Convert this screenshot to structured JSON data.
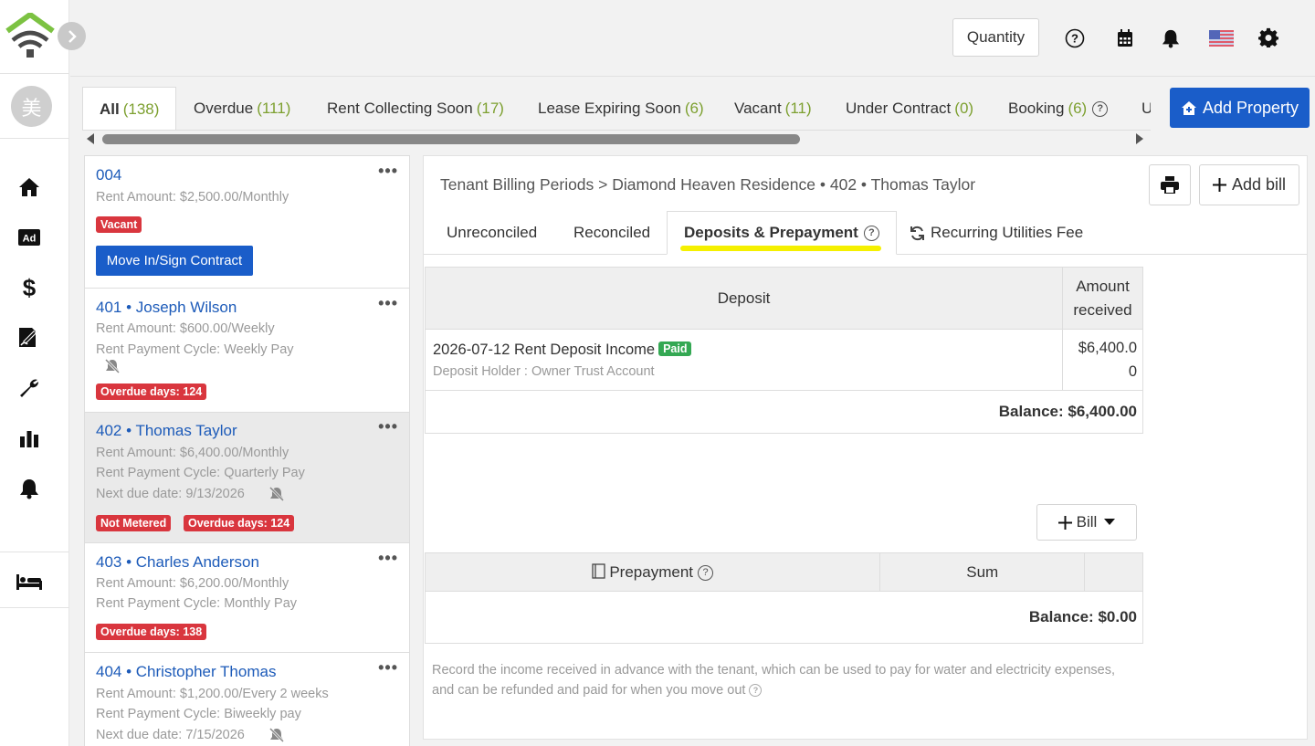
{
  "sidebar": {
    "avatar_char": "美",
    "nav_icons": [
      "home-icon",
      "ad-icon",
      "dollar-icon",
      "contract-icon",
      "wrench-icon",
      "chart-icon",
      "bell-icon",
      "bed-icon"
    ]
  },
  "topbar": {
    "quantity_label": "Quantity",
    "icons": [
      "help-icon",
      "calendar-icon",
      "notification-icon",
      "us-flag-icon",
      "settings-icon"
    ]
  },
  "property_tabs": [
    {
      "label": "All",
      "count": "(138)"
    },
    {
      "label": "Overdue",
      "count": "(111)"
    },
    {
      "label": "Rent Collecting Soon",
      "count": "(17)"
    },
    {
      "label": "Lease Expiring Soon",
      "count": "(6)"
    },
    {
      "label": "Vacant",
      "count": "(11)"
    },
    {
      "label": "Under Contract",
      "count": "(0)"
    },
    {
      "label": "Booking",
      "count": "(6)"
    },
    {
      "label": "U",
      "count": ""
    }
  ],
  "add_property_label": "Add Property",
  "properties": [
    {
      "title": "004",
      "lines": [
        "Rent Amount: $2,500.00/Monthly"
      ],
      "badges": [
        "Vacant"
      ],
      "action": "Move In/Sign Contract"
    },
    {
      "title": "401 • Joseph Wilson",
      "lines": [
        "Rent Amount: $600.00/Weekly",
        "Rent Payment Cycle: Weekly Pay"
      ],
      "badges": [
        "Overdue days: 124"
      ]
    },
    {
      "title": "402 • Thomas Taylor",
      "lines": [
        "Rent Amount: $6,400.00/Monthly",
        "Rent Payment Cycle: Quarterly Pay",
        "Next due date:  9/13/2026"
      ],
      "badges": [
        "Not Metered",
        "Overdue days: 124"
      ]
    },
    {
      "title": "403 • Charles Anderson",
      "lines": [
        "Rent Amount: $6,200.00/Monthly",
        "Rent Payment Cycle: Monthly Pay"
      ],
      "badges": [
        "Overdue days: 138"
      ]
    },
    {
      "title": "404 • Christopher Thomas",
      "lines": [
        "Rent Amount: $1,200.00/Every 2 weeks",
        "Rent Payment Cycle: Biweekly pay",
        "Next due date:  7/15/2026"
      ],
      "badges": []
    }
  ],
  "detail": {
    "breadcrumb": "Tenant Billing Periods >  Diamond Heaven Residence • 402 • Thomas Taylor",
    "add_bill_label": "Add bill",
    "tabs": [
      "Unreconciled",
      "Reconciled",
      "Deposits & Prepayment",
      "Recurring Utilities Fee"
    ],
    "deposit_table": {
      "headers": [
        "Deposit",
        "Amount received"
      ],
      "rows": [
        {
          "title": "2026-07-12 Rent Deposit Income",
          "status": "Paid",
          "holder": "Deposit Holder : Owner Trust Account",
          "amount_line1": "$6,400.0",
          "amount_line2": "0"
        }
      ],
      "balance": "Balance: $6,400.00"
    },
    "bill_button_label": "Bill",
    "prepayment_table": {
      "headers": [
        "Prepayment",
        "Sum",
        ""
      ],
      "balance": "Balance: $0.00"
    },
    "note": "Record the income received in advance with the tenant, which can be used to pay for water and electricity expenses, and can be refunded and paid for when you move out"
  },
  "colors": {
    "brand_blue": "#1a5dc9",
    "count_green": "#7da030",
    "badge_red": "#d9363e",
    "paid_green": "#34a853",
    "highlight_yellow": "#f5f000"
  }
}
